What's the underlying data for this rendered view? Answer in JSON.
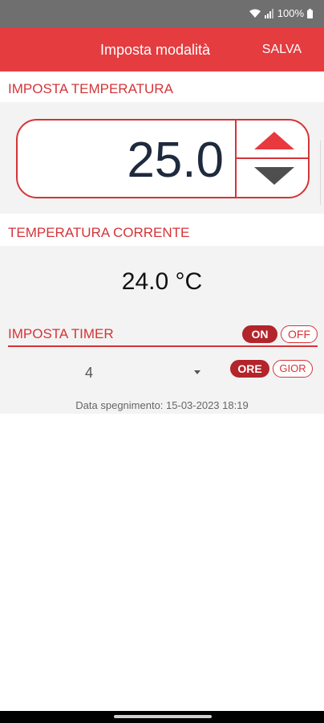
{
  "status_bar": {
    "battery": "100%"
  },
  "app_bar": {
    "title": "Imposta modalità",
    "save_label": "SALVA"
  },
  "set_temperature": {
    "header": "IMPOSTA TEMPERATURA",
    "value": "25.0"
  },
  "current_temperature": {
    "header": "TEMPERATURA CORRENTE",
    "value": "24.0 °C"
  },
  "timer": {
    "header": "IMPOSTA TIMER",
    "on_label": "ON",
    "off_label": "OFF",
    "selected_value": "4",
    "unit_hours_label": "ORE",
    "unit_days_label": "GIOR",
    "off_date": "Data spegnimento: 15-03-2023 18:19"
  },
  "colors": {
    "accent": "#e53c3f",
    "accent_dark": "#b3242b",
    "text_dark": "#1e2a3d"
  }
}
